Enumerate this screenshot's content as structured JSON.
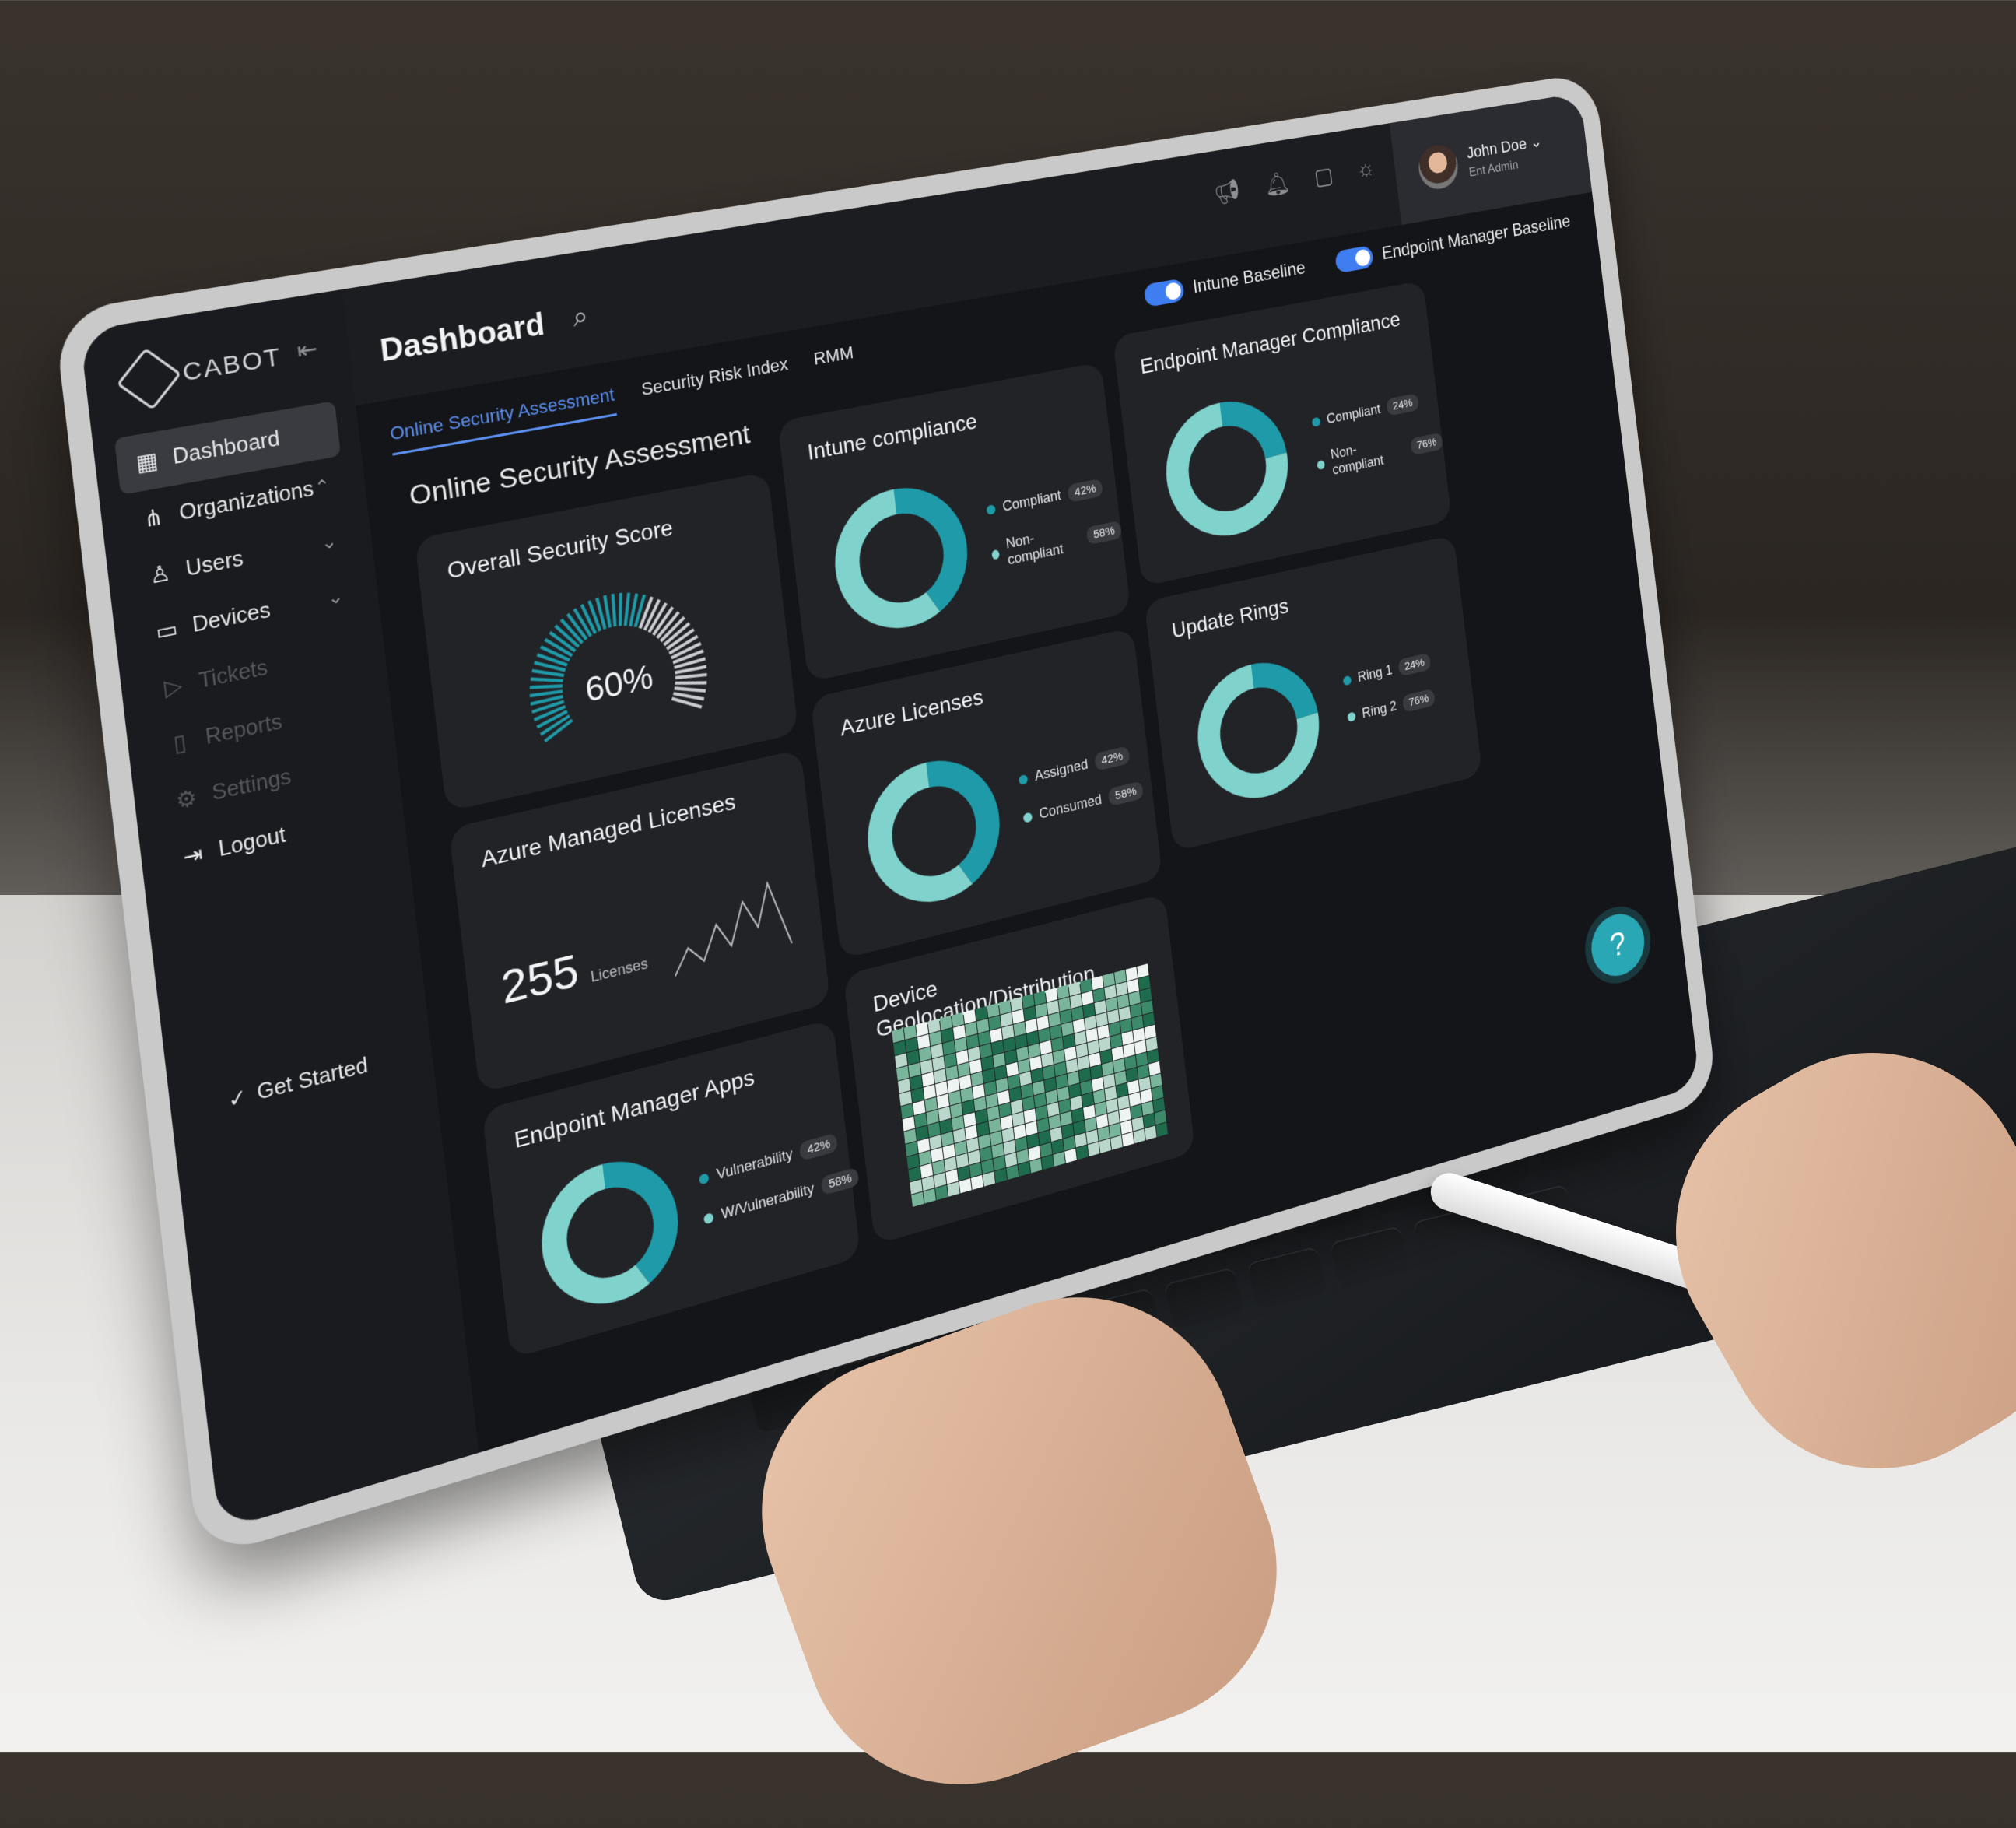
{
  "brand": "CABOT",
  "header": {
    "title": "Dashboard"
  },
  "user": {
    "name": "John Doe",
    "role": "Ent Admin"
  },
  "sidebar": {
    "items": [
      {
        "label": "Dashboard",
        "icon": "grid-icon"
      },
      {
        "label": "Organizations",
        "icon": "org-tree-icon"
      },
      {
        "label": "Users",
        "icon": "users-icon"
      },
      {
        "label": "Devices",
        "icon": "monitor-icon"
      },
      {
        "label": "Tickets",
        "icon": "ticket-icon"
      },
      {
        "label": "Reports",
        "icon": "file-icon"
      },
      {
        "label": "Settings",
        "icon": "gear-icon"
      },
      {
        "label": "Logout",
        "icon": "logout-icon"
      }
    ],
    "get_started": "Get Started"
  },
  "tabs": [
    "Online Security Assessment",
    "Security Risk Index",
    "RMM"
  ],
  "toggles": [
    "Intune Baseline",
    "Endpoint Manager Baseline"
  ],
  "section_title": "Online Security Assessment",
  "cards": {
    "security_score": {
      "title": "Overall Security Score",
      "value": "60%",
      "fraction": 0.6
    },
    "intune": {
      "title": "Intune compliance",
      "legend": [
        {
          "label": "Compliant",
          "badge": "42%",
          "value": 42
        },
        {
          "label": "Non-compliant",
          "badge": "58%",
          "value": 58
        }
      ]
    },
    "endpoint_compliance": {
      "title": "Endpoint Manager Compliance",
      "legend": [
        {
          "label": "Compliant",
          "badge": "24%",
          "value": 24
        },
        {
          "label": "Non-compliant",
          "badge": "76%",
          "value": 76
        }
      ]
    },
    "azure_managed": {
      "title": "Azure Managed Licenses",
      "value": "255",
      "unit": "Licenses"
    },
    "azure_licenses": {
      "title": "Azure Licenses",
      "legend": [
        {
          "label": "Assigned",
          "badge": "42%",
          "value": 42
        },
        {
          "label": "Consumed",
          "badge": "58%",
          "value": 58
        }
      ]
    },
    "update_rings": {
      "title": "Update Rings",
      "legend": [
        {
          "label": "Ring 1",
          "badge": "24%",
          "value": 24
        },
        {
          "label": "Ring 2",
          "badge": "76%",
          "value": 76
        }
      ]
    },
    "endpoint_apps": {
      "title": "Endpoint Manager Apps",
      "legend": [
        {
          "label": "Vulnerability",
          "badge": "42%",
          "value": 42
        },
        {
          "label": "W/Vulnerability",
          "badge": "58%",
          "value": 58
        }
      ]
    },
    "geolocation": {
      "title": "Device Geolocation/Distribution"
    }
  },
  "colors": {
    "accent_light": "#7fd3cc",
    "accent_dark": "#1f9aa8",
    "tab_active": "#5a8dee",
    "toggle": "#3f7ef0"
  }
}
